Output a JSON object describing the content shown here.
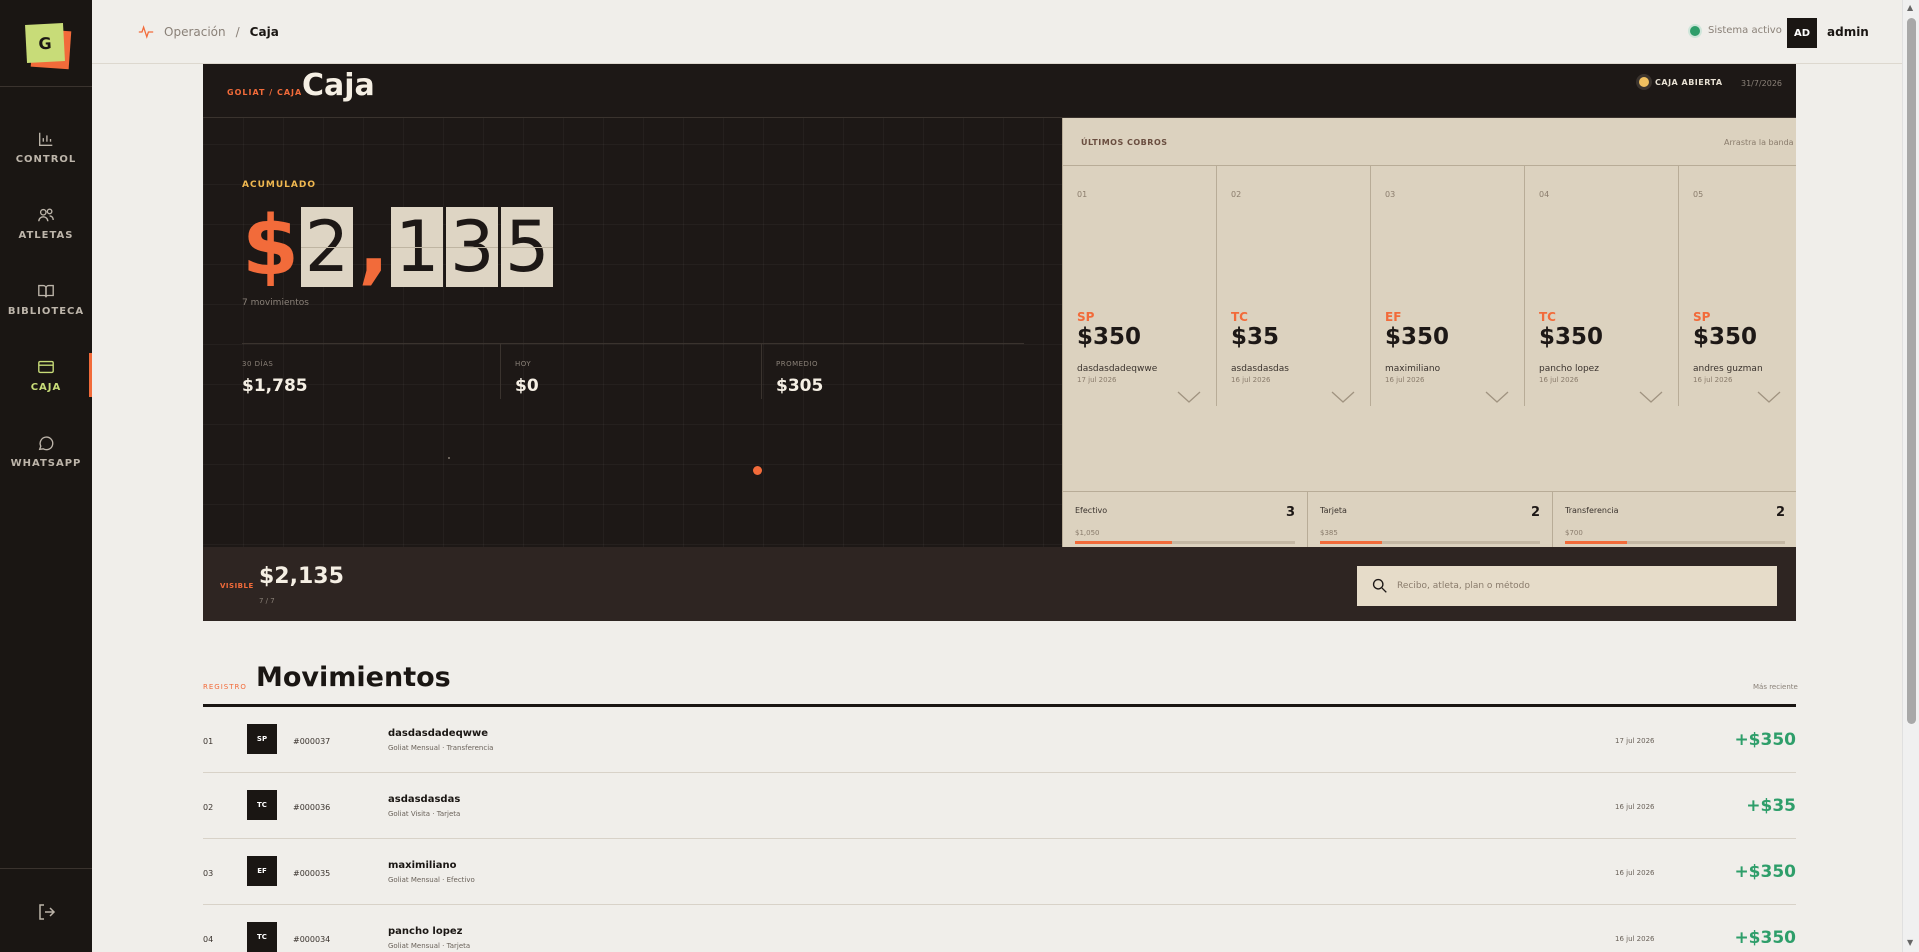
{
  "app": {
    "logo_letter": "G"
  },
  "sidebar": {
    "items": [
      {
        "label": "CONTROL",
        "icon": "bar-chart-icon"
      },
      {
        "label": "ATLETAS",
        "icon": "users-icon"
      },
      {
        "label": "BIBLIOTECA",
        "icon": "book-icon"
      },
      {
        "label": "CAJA",
        "icon": "card-icon",
        "active": true
      },
      {
        "label": "WHATSAPP",
        "icon": "chat-icon"
      }
    ]
  },
  "topbar": {
    "breadcrumb_root": "Operación",
    "breadcrumb_sep": "/",
    "breadcrumb_current": "Caja",
    "system_status": "Sistema activo",
    "user_initials": "AD",
    "user_name": "admin"
  },
  "hero": {
    "kicker": "GOLIAT / CAJA",
    "title": "Caja",
    "status": "CAJA ABIERTA",
    "date": "31/7/2026",
    "accumulated_label": "ACUMULADO",
    "currency": "$",
    "digits": [
      "2",
      ",",
      "1",
      "3",
      "5"
    ],
    "movements": "7 movimientos",
    "stats": [
      {
        "label": "30 DÍAS",
        "value": "$1,785"
      },
      {
        "label": "HOY",
        "value": "$0"
      },
      {
        "label": "PROMEDIO",
        "value": "$305"
      }
    ]
  },
  "cobros": {
    "title": "ÚLTIMOS COBROS",
    "hint": "Arrastra la banda",
    "items": [
      {
        "n": "01",
        "method": "SP",
        "amount": "$350",
        "person": "dasdasdadeqwwe",
        "date": "17 jul 2026"
      },
      {
        "n": "02",
        "method": "TC",
        "amount": "$35",
        "person": "asdasdasdas",
        "date": "16 jul 2026"
      },
      {
        "n": "03",
        "method": "EF",
        "amount": "$350",
        "person": "maximiliano",
        "date": "16 jul 2026"
      },
      {
        "n": "04",
        "method": "TC",
        "amount": "$350",
        "person": "pancho lopez",
        "date": "16 jul 2026"
      },
      {
        "n": "05",
        "method": "SP",
        "amount": "$350",
        "person": "andres guzman",
        "date": "16 jul 2026"
      }
    ],
    "methods": [
      {
        "label": "Efectivo",
        "count": "3",
        "amount": "$1,050",
        "share": 0.44
      },
      {
        "label": "Tarjeta",
        "count": "2",
        "amount": "$385",
        "share": 0.28
      },
      {
        "label": "Transferencia",
        "count": "2",
        "amount": "$700",
        "share": 0.28
      }
    ]
  },
  "visible": {
    "label": "VISIBLE",
    "value": "$2,135",
    "count": "7 / 7",
    "search_placeholder": "Recibo, atleta, plan o método"
  },
  "movimientos": {
    "kicker": "REGISTRO",
    "title": "Movimientos",
    "sort": "Más reciente",
    "rows": [
      {
        "idx": "01",
        "badge": "SP",
        "receipt": "#000037",
        "name": "dasdasdadeqwwe",
        "plan": "Goliat Mensual · Transferencia",
        "date": "17 jul 2026",
        "amount": "+$350"
      },
      {
        "idx": "02",
        "badge": "TC",
        "receipt": "#000036",
        "name": "asdasdasdas",
        "plan": "Goliat Visita · Tarjeta",
        "date": "16 jul 2026",
        "amount": "+$35"
      },
      {
        "idx": "03",
        "badge": "EF",
        "receipt": "#000035",
        "name": "maximiliano",
        "plan": "Goliat Mensual · Efectivo",
        "date": "16 jul 2026",
        "amount": "+$350"
      },
      {
        "idx": "04",
        "badge": "TC",
        "receipt": "#000034",
        "name": "pancho lopez",
        "plan": "Goliat Mensual · Tarjeta",
        "date": "16 jul 2026",
        "amount": "+$350"
      }
    ]
  },
  "colors": {
    "accent": "#f26b3a",
    "positive": "#2e9e6a",
    "logo": "#c8dc78",
    "dark": "#1d1816",
    "band": "#dcd2bf"
  }
}
